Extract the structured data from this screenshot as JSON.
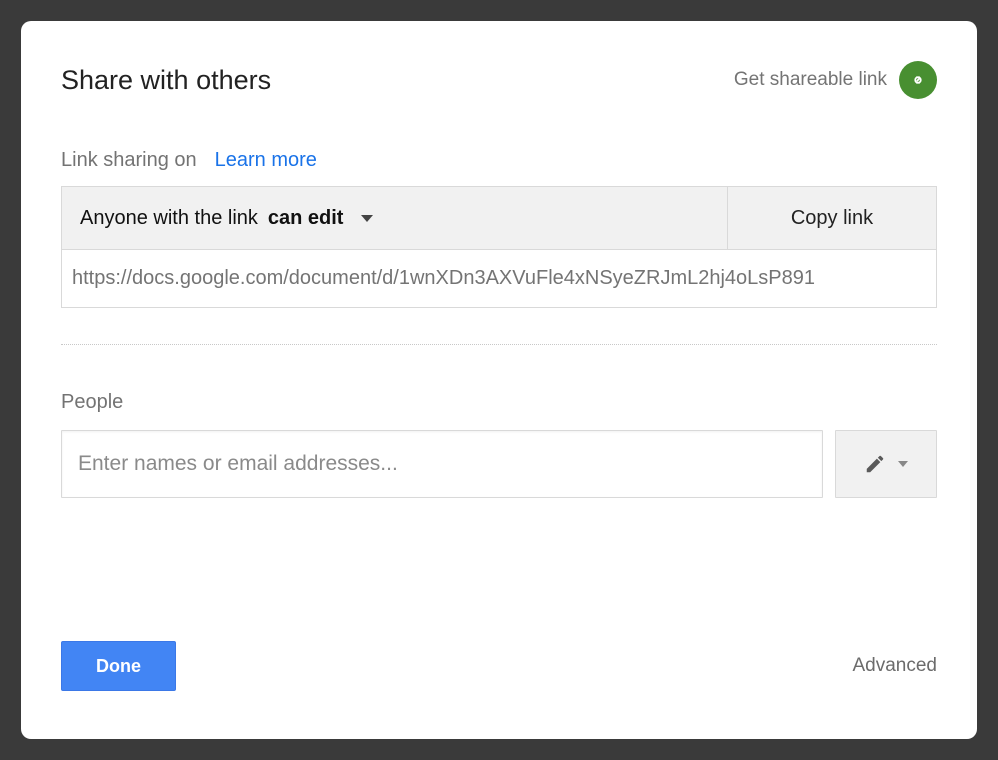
{
  "dialog": {
    "title": "Share with others",
    "shareable_label": "Get shareable link"
  },
  "link_sharing": {
    "status_label": "Link sharing on",
    "learn_more": "Learn more",
    "permission_prefix": "Anyone with the link",
    "permission_level": "can edit",
    "copy_button": "Copy link",
    "url": "https://docs.google.com/document/d/1wnXDn3AXVuFle4xNSyeZRJmL2hj4oLsP891"
  },
  "people": {
    "section_label": "People",
    "placeholder": "Enter names or email addresses..."
  },
  "footer": {
    "done": "Done",
    "advanced": "Advanced"
  }
}
